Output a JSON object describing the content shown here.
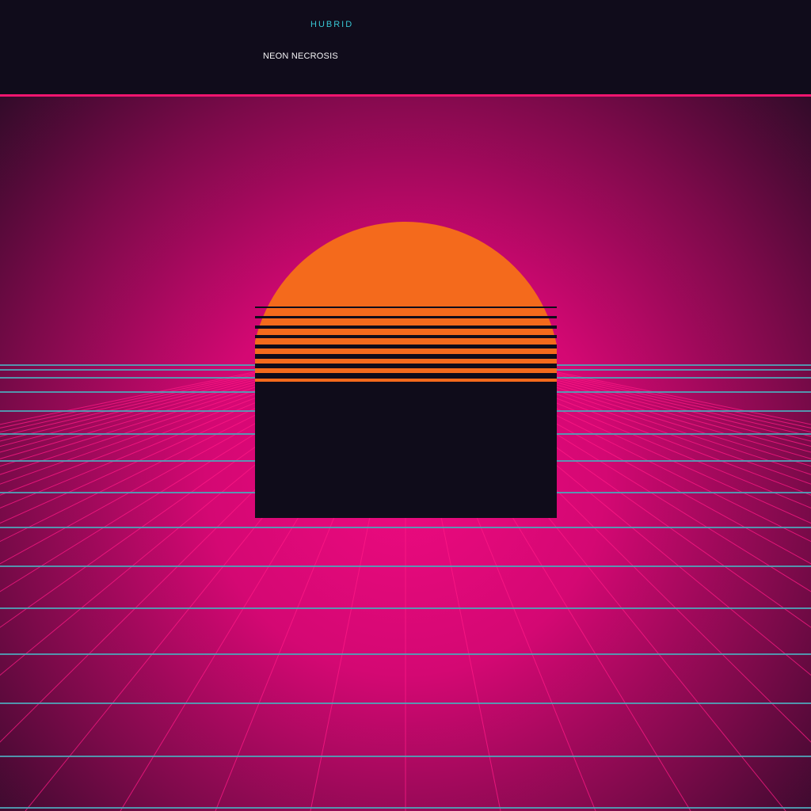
{
  "header": {
    "brand": "HUBRID",
    "title": "NEON NECROSIS"
  },
  "colors": {
    "background": "#100c1b",
    "accent_pink": "#f0156f",
    "glow_magenta": "#e4087a",
    "sun_orange": "#f46a1c",
    "grid_cyan": "#4fa4b8",
    "grid_pink": "#ff1a86",
    "brand_cyan": "#38c6d4"
  },
  "artwork": {
    "elements": [
      "retro-sun",
      "perspective-grid",
      "dark-block"
    ]
  }
}
